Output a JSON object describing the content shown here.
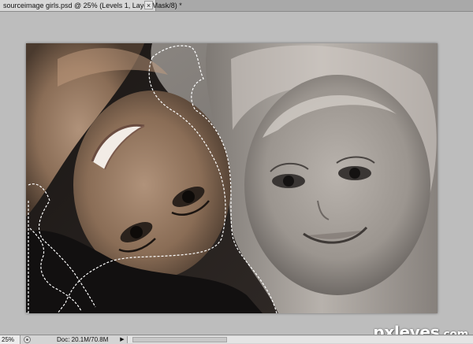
{
  "document": {
    "tab_title": "sourceimage girls.psd @ 25% (Levels 1, Layer Mask/8) *",
    "close_glyph": "×"
  },
  "status": {
    "zoom": "25%",
    "doc_info": "Doc: 20.1M/70.8M",
    "arrow_glyph": "▶"
  },
  "watermark": {
    "brand": "pxleyes",
    "suffix": ".com"
  },
  "colors": {
    "workspace": "#bdbdbd",
    "selection_marquee": "#ffffff"
  },
  "icons": {
    "close": "close-icon",
    "status_menu": "status-menu-icon",
    "arrow": "arrow-right-icon"
  }
}
